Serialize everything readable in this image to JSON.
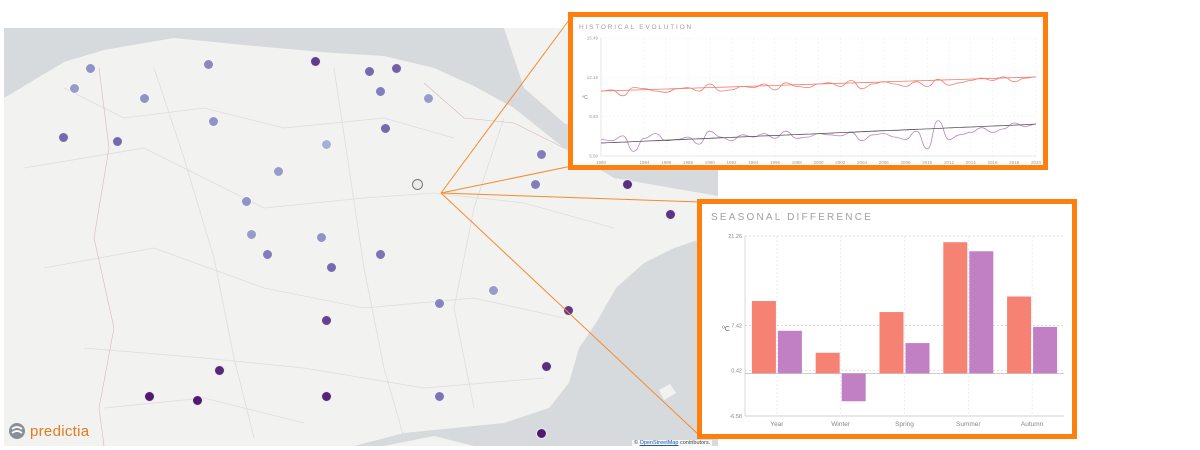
{
  "app": {
    "logo_text": "predictia"
  },
  "map": {
    "attribution_prefix": "©",
    "attribution_link": "OpenStreetMap",
    "attribution_suffix": "contributors.",
    "stations": [
      {
        "lon": -7.9,
        "lat": 43.4,
        "value": 0.35
      },
      {
        "lon": -5.7,
        "lat": 43.45,
        "value": 0.4
      },
      {
        "lon": -3.7,
        "lat": 43.5,
        "value": 0.78
      },
      {
        "lon": -2.7,
        "lat": 43.35,
        "value": 0.55
      },
      {
        "lon": -2.2,
        "lat": 43.4,
        "value": 0.6
      },
      {
        "lon": -8.2,
        "lat": 43.1,
        "value": 0.3
      },
      {
        "lon": -6.9,
        "lat": 42.95,
        "value": 0.35
      },
      {
        "lon": -2.5,
        "lat": 43.05,
        "value": 0.45
      },
      {
        "lon": -1.6,
        "lat": 42.95,
        "value": 0.3
      },
      {
        "lon": -5.6,
        "lat": 42.6,
        "value": 0.35
      },
      {
        "lon": -2.4,
        "lat": 42.5,
        "value": 0.55
      },
      {
        "lon": -8.4,
        "lat": 42.35,
        "value": 0.55
      },
      {
        "lon": -7.4,
        "lat": 42.3,
        "value": 0.55
      },
      {
        "lon": -3.5,
        "lat": 42.25,
        "value": 0.2
      },
      {
        "lon": 0.5,
        "lat": 42.1,
        "value": 0.45
      },
      {
        "lon": -4.4,
        "lat": 41.85,
        "value": 0.3
      },
      {
        "lon": -1.8,
        "lat": 41.65,
        "value": 0.0
      },
      {
        "lon": 0.4,
        "lat": 41.65,
        "value": 0.45
      },
      {
        "lon": 2.1,
        "lat": 41.65,
        "value": 0.85
      },
      {
        "lon": -5.0,
        "lat": 41.4,
        "value": 0.35
      },
      {
        "lon": 2.9,
        "lat": 41.2,
        "value": 0.82
      },
      {
        "lon": -4.9,
        "lat": 40.9,
        "value": 0.3
      },
      {
        "lon": -3.6,
        "lat": 40.85,
        "value": 0.35
      },
      {
        "lon": -4.6,
        "lat": 40.6,
        "value": 0.45
      },
      {
        "lon": -2.5,
        "lat": 40.6,
        "value": 0.5
      },
      {
        "lon": -3.4,
        "lat": 40.4,
        "value": 0.55
      },
      {
        "lon": -0.4,
        "lat": 40.05,
        "value": 0.3
      },
      {
        "lon": 1.0,
        "lat": 39.75,
        "value": 0.8
      },
      {
        "lon": -1.4,
        "lat": 39.85,
        "value": 0.42
      },
      {
        "lon": -3.5,
        "lat": 39.6,
        "value": 0.75
      },
      {
        "lon": -5.5,
        "lat": 38.85,
        "value": 0.88
      },
      {
        "lon": 0.6,
        "lat": 38.9,
        "value": 0.85
      },
      {
        "lon": -6.8,
        "lat": 38.45,
        "value": 0.95
      },
      {
        "lon": -5.9,
        "lat": 38.4,
        "value": 0.95
      },
      {
        "lon": -3.5,
        "lat": 38.45,
        "value": 0.9
      },
      {
        "lon": -1.4,
        "lat": 38.45,
        "value": 0.5
      },
      {
        "lon": 0.5,
        "lat": 37.9,
        "value": 0.95
      }
    ],
    "selected": {
      "lon": -1.8,
      "lat": 41.65
    }
  },
  "historical_panel": {
    "title": "HISTORICAL EVOLUTION",
    "chart_data": {
      "type": "line",
      "x": [
        1980,
        1981,
        1982,
        1983,
        1984,
        1985,
        1986,
        1987,
        1988,
        1989,
        1990,
        1991,
        1992,
        1993,
        1994,
        1995,
        1996,
        1997,
        1998,
        1999,
        2000,
        2001,
        2002,
        2003,
        2004,
        2005,
        2006,
        2007,
        2008,
        2009,
        2010,
        2011,
        2012,
        2013,
        2014,
        2015,
        2016,
        2017,
        2018,
        2019,
        2020
      ],
      "x_tick_labels": [
        "1980",
        "1984",
        "1986",
        "1988",
        "1990",
        "1992",
        "1994",
        "1996",
        "1998",
        "2000",
        "2002",
        "2004",
        "2006",
        "2008",
        "2010",
        "2012",
        "2014",
        "2016",
        "2018",
        "2020"
      ],
      "ylabel": "ºC",
      "ylim": [
        5.5,
        15.5
      ],
      "yticks": [
        "5.50",
        "8.83",
        "12.16",
        "15.49"
      ],
      "series": [
        {
          "color": "#f07c6e",
          "values": [
            11.0,
            11.1,
            10.6,
            11.3,
            11.2,
            11.0,
            10.9,
            11.2,
            11.3,
            11.0,
            11.6,
            11.0,
            11.1,
            11.4,
            11.3,
            11.6,
            11.1,
            11.7,
            11.4,
            11.3,
            11.6,
            11.7,
            11.4,
            11.9,
            11.2,
            11.6,
            11.8,
            11.6,
            11.4,
            11.8,
            11.4,
            12.0,
            11.5,
            11.7,
            11.9,
            12.1,
            11.9,
            12.2,
            11.8,
            12.1,
            12.2
          ]
        },
        {
          "color": "#f07c6e",
          "values": [
            11.0,
            11.03,
            11.06,
            11.09,
            11.12,
            11.15,
            11.18,
            11.21,
            11.24,
            11.27,
            11.3,
            11.33,
            11.36,
            11.39,
            11.42,
            11.45,
            11.48,
            11.51,
            11.54,
            11.57,
            11.6,
            11.63,
            11.66,
            11.69,
            11.72,
            11.75,
            11.78,
            11.81,
            11.84,
            11.87,
            11.9,
            11.93,
            11.96,
            11.99,
            12.02,
            12.05,
            12.08,
            12.11,
            12.14,
            12.17,
            12.2
          ]
        },
        {
          "color": "#c17fc4",
          "values": [
            6.9,
            6.8,
            7.2,
            5.9,
            7.0,
            7.4,
            6.8,
            6.9,
            7.1,
            6.5,
            7.6,
            7.1,
            6.8,
            7.3,
            7.1,
            7.4,
            7.0,
            7.6,
            7.0,
            7.1,
            7.4,
            7.3,
            7.2,
            7.5,
            6.8,
            7.3,
            7.4,
            7.1,
            6.9,
            7.6,
            6.1,
            8.5,
            6.9,
            7.3,
            7.5,
            7.9,
            7.5,
            7.8,
            8.3,
            8.0,
            8.2
          ]
        },
        {
          "color": "#555555",
          "values": [
            6.6,
            6.64,
            6.68,
            6.72,
            6.76,
            6.8,
            6.84,
            6.88,
            6.92,
            6.96,
            7.0,
            7.04,
            7.08,
            7.12,
            7.16,
            7.2,
            7.24,
            7.28,
            7.32,
            7.36,
            7.4,
            7.44,
            7.48,
            7.52,
            7.56,
            7.6,
            7.64,
            7.68,
            7.72,
            7.76,
            7.8,
            7.84,
            7.88,
            7.92,
            7.96,
            8.0,
            8.04,
            8.08,
            8.12,
            8.16,
            8.2
          ]
        }
      ]
    }
  },
  "seasonal_panel": {
    "title": "SEASONAL DIFFERENCE",
    "chart_data": {
      "type": "bar",
      "categories": [
        "Year",
        "Winter",
        "Spring",
        "Summer",
        "Autumn"
      ],
      "series": [
        {
          "color": "#f58273",
          "values": [
            11.2,
            3.2,
            9.5,
            20.3,
            11.9
          ]
        },
        {
          "color": "#c17fc4",
          "values": [
            6.6,
            -4.3,
            4.7,
            18.9,
            7.2
          ]
        }
      ],
      "ylabel": "ºC",
      "yticks": [
        "21.26",
        "7.42",
        "0.42",
        "-6.58"
      ],
      "ylim": [
        -6.58,
        21.26
      ]
    }
  },
  "colors": {
    "accent": "#ff7f0e",
    "low": "#c2d8ec",
    "mid": "#7c74b4",
    "high": "#4b1068"
  }
}
